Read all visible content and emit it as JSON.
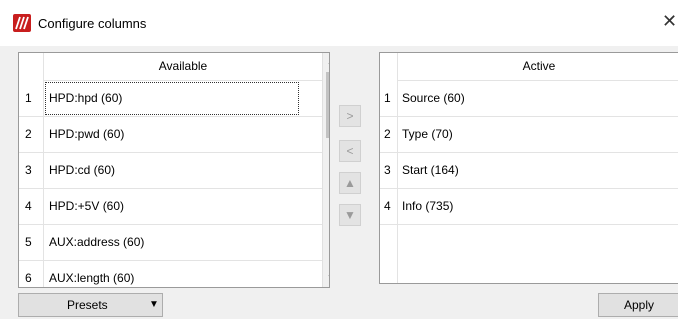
{
  "window": {
    "title": "Configure columns",
    "close_glyph": "✕"
  },
  "available": {
    "header": "Available",
    "rows": [
      {
        "num": "1",
        "label": "HPD:hpd (60)"
      },
      {
        "num": "2",
        "label": "HPD:pwd (60)"
      },
      {
        "num": "3",
        "label": "HPD:cd (60)"
      },
      {
        "num": "4",
        "label": "HPD:+5V (60)"
      },
      {
        "num": "5",
        "label": "AUX:address (60)"
      },
      {
        "num": "6",
        "label": "AUX:length (60)"
      }
    ]
  },
  "active": {
    "header": "Active",
    "rows": [
      {
        "num": "1",
        "label": "Source (60)"
      },
      {
        "num": "2",
        "label": "Type (70)"
      },
      {
        "num": "3",
        "label": "Start (164)"
      },
      {
        "num": "4",
        "label": "Info (735)"
      }
    ]
  },
  "middle_buttons": {
    "add": ">",
    "remove": "<",
    "up": "▲",
    "down": "▼"
  },
  "scrollbar": {
    "up": "▲",
    "down": "▼"
  },
  "buttons": {
    "presets": "Presets",
    "presets_caret": "▼",
    "apply": "Apply"
  },
  "colors": {
    "brand": "#c81e1e"
  }
}
